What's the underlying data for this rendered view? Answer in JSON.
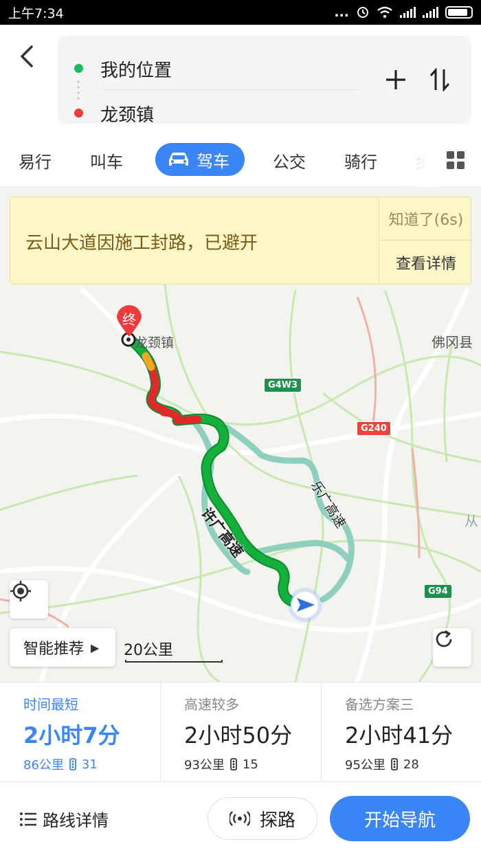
{
  "status_bar": {
    "time": "上午7:34",
    "dots": "..."
  },
  "search": {
    "from": "我的位置",
    "to": "龙颈镇"
  },
  "tabs": [
    {
      "label": "易行"
    },
    {
      "label": "叫车"
    },
    {
      "label": "驾车",
      "active": true
    },
    {
      "label": "公交"
    },
    {
      "label": "骑行"
    },
    {
      "label": "步"
    }
  ],
  "notice": {
    "text": "云山大道因施工封路，已避开",
    "dismiss_label": "知道了(6s)",
    "detail_label": "查看详情"
  },
  "map": {
    "destination_label": "龙颈镇",
    "end_marker": "终",
    "county_label": "佛冈县",
    "edge_label": "从",
    "road_badges": [
      "G4W3",
      "G240",
      "G94"
    ],
    "highway_names": {
      "main": "许广高速",
      "alt": "乐广高速"
    },
    "recommend_label": "智能推荐",
    "scale_label": "20公里"
  },
  "route_options": [
    {
      "label": "时间最短",
      "time": "2小时7分",
      "distance": "86公里",
      "lights": "31",
      "active": true
    },
    {
      "label": "高速较多",
      "time": "2小时50分",
      "distance": "93公里",
      "lights": "15"
    },
    {
      "label": "备选方案三",
      "time": "2小时41分",
      "distance": "95公里",
      "lights": "28"
    }
  ],
  "bottom": {
    "detail_label": "路线详情",
    "explore_label": "探路",
    "start_label": "开始导航"
  },
  "colors": {
    "accent": "#3b86f7",
    "route_green": "#14b03c",
    "route_red": "#e0292b",
    "alt_route": "#8ecfbd",
    "notice_bg": "#fdf6c7"
  }
}
